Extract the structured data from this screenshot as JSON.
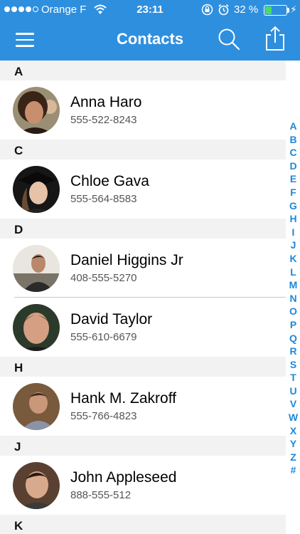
{
  "status_bar": {
    "signal_dots": 4,
    "carrier": "Orange F",
    "time": "23:11",
    "battery_percent": "32 %",
    "battery_level": 0.32
  },
  "nav": {
    "title": "Contacts",
    "icons": [
      "menu-icon",
      "search-icon",
      "share-icon"
    ]
  },
  "sections": [
    {
      "letter": "A",
      "contacts": [
        {
          "name": "Anna Haro",
          "phone": "555-522-8243"
        }
      ]
    },
    {
      "letter": "C",
      "contacts": [
        {
          "name": "Chloe Gava",
          "phone": "555-564-8583"
        }
      ]
    },
    {
      "letter": "D",
      "contacts": [
        {
          "name": "Daniel Higgins Jr",
          "phone": "408-555-5270"
        },
        {
          "name": "David Taylor",
          "phone": "555-610-6679"
        }
      ]
    },
    {
      "letter": "H",
      "contacts": [
        {
          "name": "Hank M. Zakroff",
          "phone": "555-766-4823"
        }
      ]
    },
    {
      "letter": "J",
      "contacts": [
        {
          "name": "John Appleseed",
          "phone": "888-555-512"
        }
      ]
    },
    {
      "letter": "K",
      "contacts": []
    }
  ],
  "index_letters": [
    "A",
    "B",
    "C",
    "D",
    "E",
    "F",
    "G",
    "H",
    "I",
    "J",
    "K",
    "L",
    "M",
    "N",
    "O",
    "P",
    "Q",
    "R",
    "S",
    "T",
    "U",
    "V",
    "W",
    "X",
    "Y",
    "Z",
    "#"
  ],
  "colors": {
    "accent": "#2e8fdf",
    "index_text": "#1e88d9",
    "section_bg": "#f2f2f2",
    "battery_green": "#4cd964"
  }
}
